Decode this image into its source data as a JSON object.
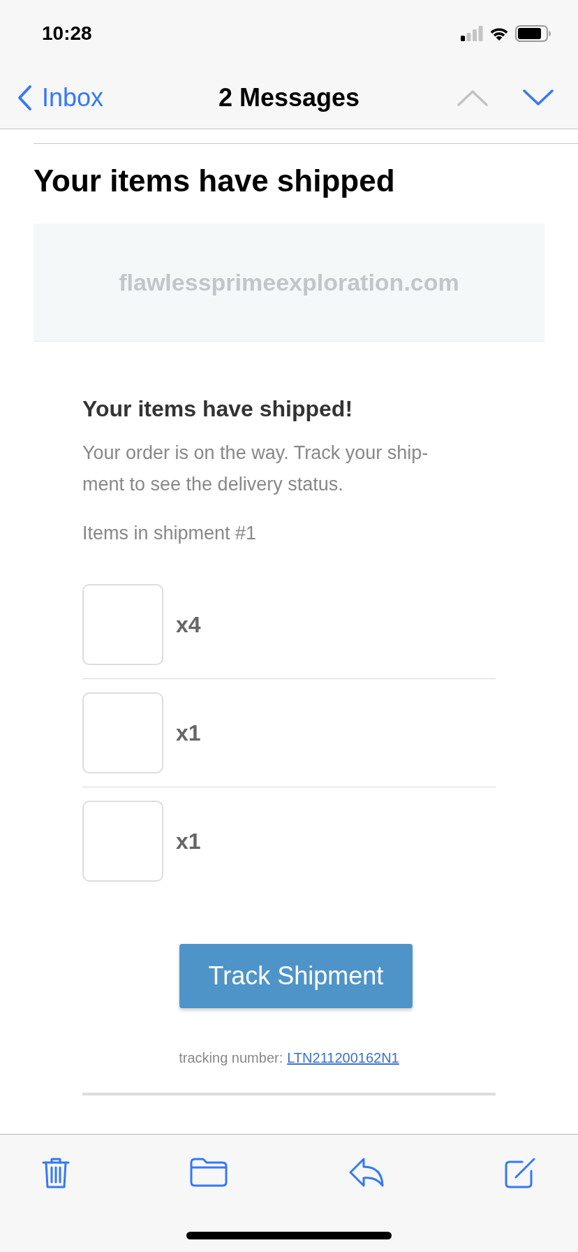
{
  "status_bar": {
    "time": "10:28"
  },
  "nav_bar": {
    "back_label": "Inbox",
    "title": "2 Messages",
    "arrows": [
      {
        "kind": "up",
        "disabled": true
      },
      {
        "kind": "down",
        "disabled": false
      }
    ]
  },
  "message": {
    "subject": "Your items have shipped",
    "banner": "flawlessprimeexploration.com",
    "heading": "Your items have shipped!",
    "body": "Your order is on the way. Track your ship-ment to see the delivery status.",
    "items_label": "Items in shipment #1",
    "items": [
      {
        "quantity": "x4"
      },
      {
        "quantity": "x1"
      },
      {
        "quantity": "x1"
      }
    ],
    "button": "Track Shipment",
    "tracking_label": "tracking number:",
    "tracking_number": "LTN211200162N1"
  },
  "toolbar": [
    {
      "kind": "trash"
    },
    {
      "kind": "folder"
    },
    {
      "kind": "reply"
    },
    {
      "kind": "compose"
    }
  ]
}
